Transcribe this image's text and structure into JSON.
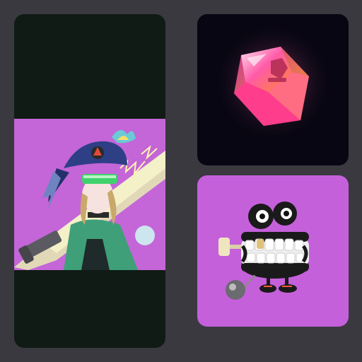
{
  "colors": {
    "background": "#3a3940",
    "card_dark": "#101b15",
    "card_black": "#080612",
    "art_purple": "#c465d8",
    "teeth_purple": "#c560db"
  },
  "gallery": {
    "cards": [
      {
        "name": "anime-character-art-card",
        "subject": "character-with-bird-mask-cap-and-glowing-bat"
      },
      {
        "name": "crystal-gem-card",
        "subject": "glowing-pink-crystal-gem"
      },
      {
        "name": "wind-up-teeth-card",
        "subject": "wind-up-chattering-teeth-toy-with-ball-and-chain"
      }
    ]
  }
}
